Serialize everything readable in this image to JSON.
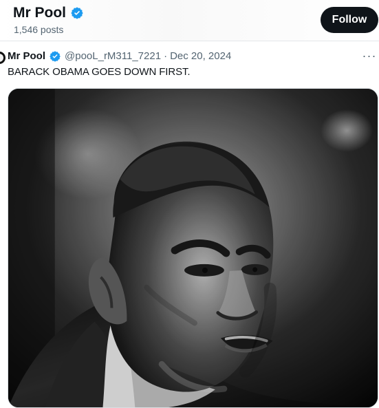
{
  "profile": {
    "name": "Mr Pool",
    "posts_count": "1,546 posts",
    "follow_label": "Follow",
    "verified_icon": "verified-badge-icon"
  },
  "post": {
    "author": "Mr Pool",
    "handle": "@pooL_rM311_7221",
    "separator": "·",
    "date": "Dec 20, 2024",
    "text": "BARACK OBAMA GOES DOWN FIRST.",
    "more_label": "···",
    "media_icon": "portrait-photo",
    "verified_icon": "verified-badge-icon"
  },
  "colors": {
    "text": "#0f1419",
    "secondary_text": "#536471",
    "verified_blue": "#1d9bf0",
    "follow_bg": "#0f1419",
    "follow_text": "#ffffff"
  }
}
